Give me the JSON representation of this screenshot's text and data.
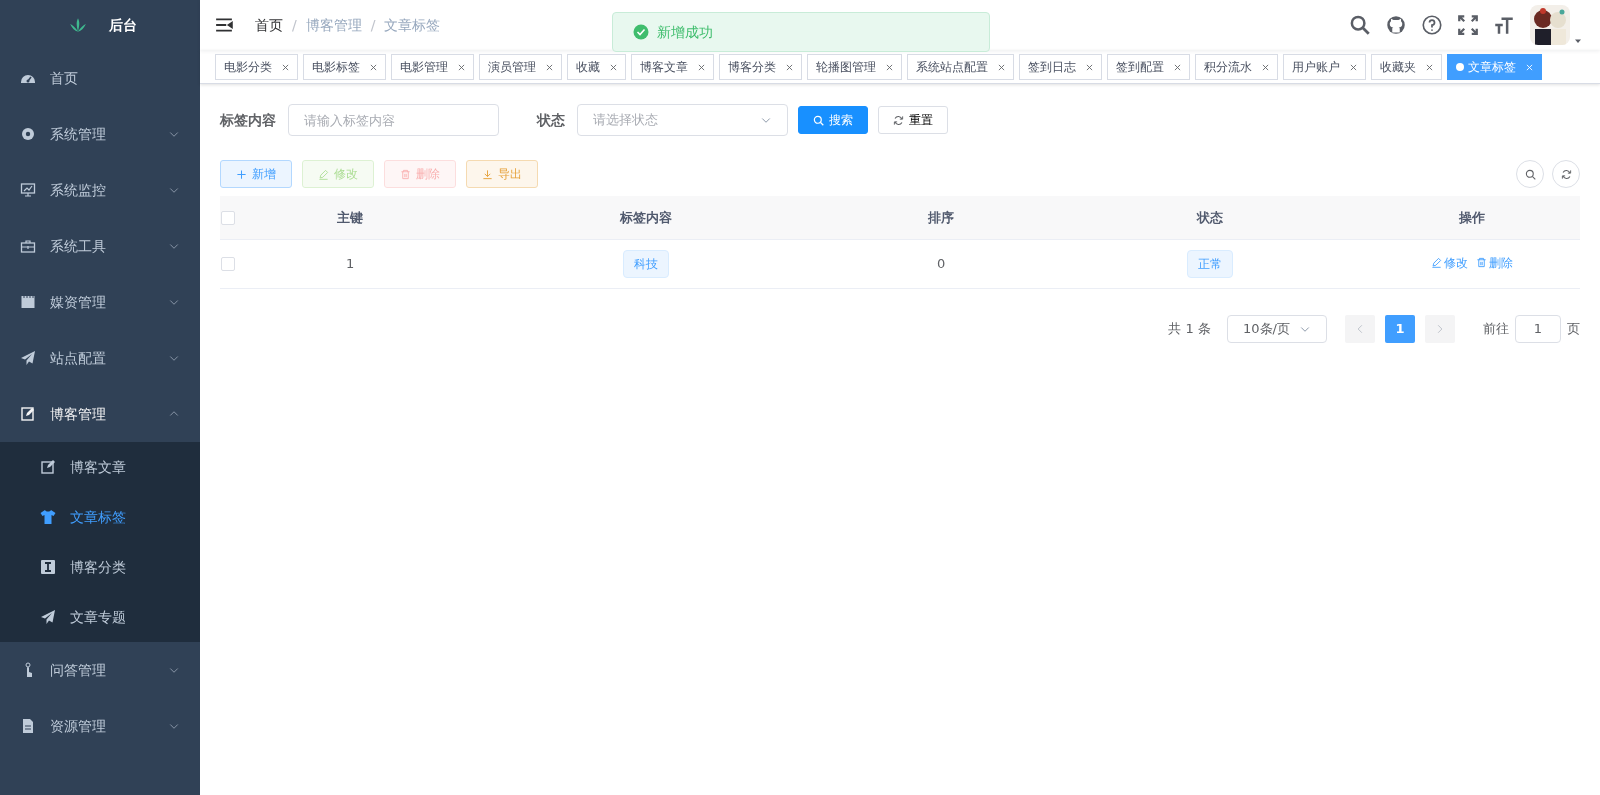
{
  "sidebar": {
    "logo_text": "后台",
    "items": [
      {
        "label": "首页",
        "selected": false
      },
      {
        "label": "系统管理",
        "expanded": false,
        "selected": false
      },
      {
        "label": "系统监控",
        "expanded": false,
        "selected": false
      },
      {
        "label": "系统工具",
        "expanded": false,
        "selected": false
      },
      {
        "label": "媒资管理",
        "expanded": false,
        "selected": false
      },
      {
        "label": "站点配置",
        "expanded": false,
        "selected": false
      },
      {
        "label": "博客管理",
        "expanded": true,
        "selected": false,
        "children": [
          {
            "label": "博客文章",
            "selected": false
          },
          {
            "label": "文章标签",
            "selected": true
          },
          {
            "label": "博客分类",
            "selected": false
          },
          {
            "label": "文章专题",
            "selected": false
          }
        ]
      },
      {
        "label": "问答管理",
        "expanded": false,
        "selected": false
      },
      {
        "label": "资源管理",
        "expanded": false,
        "selected": false
      }
    ]
  },
  "breadcrumb": [
    {
      "kind": "link",
      "text": "首页"
    },
    {
      "kind": "separator",
      "text": "/"
    },
    {
      "kind": "link",
      "text": "博客管理"
    },
    {
      "kind": "separator",
      "text": "/"
    },
    {
      "kind": "current",
      "text": "文章标签"
    }
  ],
  "tags": [
    {
      "label": "电影分类",
      "selected": false
    },
    {
      "label": "电影标签",
      "selected": false
    },
    {
      "label": "电影管理",
      "selected": false
    },
    {
      "label": "演员管理",
      "selected": false
    },
    {
      "label": "收藏",
      "selected": false
    },
    {
      "label": "博客文章",
      "selected": false
    },
    {
      "label": "博客分类",
      "selected": false
    },
    {
      "label": "轮播图管理",
      "selected": false
    },
    {
      "label": "系统站点配置",
      "selected": false
    },
    {
      "label": "签到日志",
      "selected": false
    },
    {
      "label": "签到配置",
      "selected": false
    },
    {
      "label": "积分流水",
      "selected": false
    },
    {
      "label": "用户账户",
      "selected": false
    },
    {
      "label": "收藏夹",
      "selected": false
    },
    {
      "label": "文章标签",
      "selected": true
    }
  ],
  "toast": {
    "message": "新增成功"
  },
  "search_form": {
    "fields": [
      {
        "label": "标签内容",
        "kind": "input",
        "placeholder": "请输入标签内容"
      },
      {
        "label": "状态",
        "kind": "select",
        "placeholder": "请选择状态"
      }
    ],
    "search_button": "搜索",
    "reset_button": "重置"
  },
  "toolbar": [
    {
      "label": "新增",
      "kind": "add",
      "disabled": false
    },
    {
      "label": "修改",
      "kind": "edit",
      "disabled": true
    },
    {
      "label": "删除",
      "kind": "delete",
      "disabled": true
    },
    {
      "label": "导出",
      "kind": "export",
      "disabled": false
    }
  ],
  "table": {
    "select_all_checked": false,
    "columns": [
      "主键",
      "标签内容",
      "排序",
      "状态",
      "操作"
    ],
    "rows": [
      {
        "checked": false,
        "id": "1",
        "tag": "科技",
        "sort": "0",
        "status": "正常",
        "actions": [
          "修改",
          "删除"
        ]
      }
    ]
  },
  "pagination": {
    "total": "共 1 条",
    "page_size": "10条/页",
    "pages": [
      {
        "label": "1",
        "selected": true
      }
    ],
    "goto_label": "前往",
    "goto_value": "1",
    "page_suffix": "页"
  }
}
